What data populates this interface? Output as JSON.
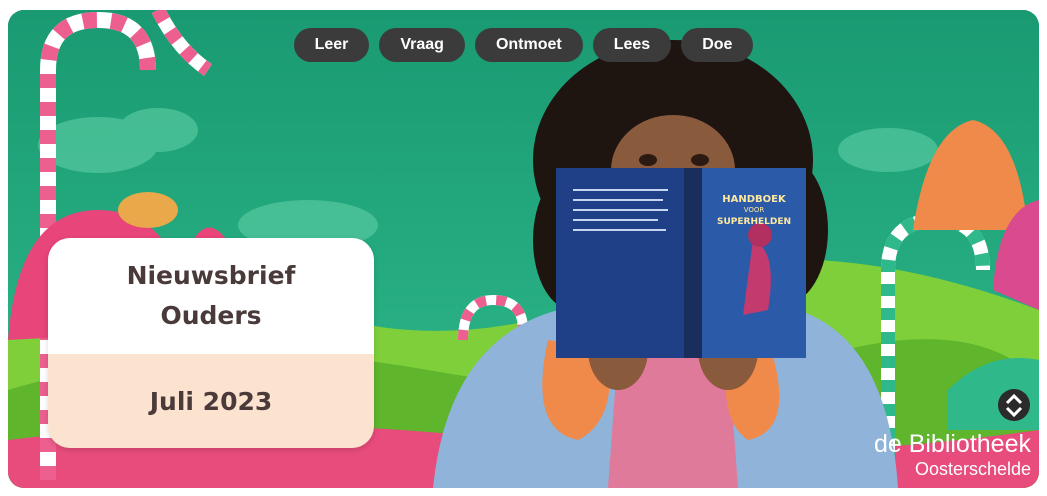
{
  "nav": {
    "items": [
      {
        "label": "Leer"
      },
      {
        "label": "Vraag"
      },
      {
        "label": "Ontmoet"
      },
      {
        "label": "Lees"
      },
      {
        "label": "Doe"
      }
    ]
  },
  "card": {
    "title_line1": "Nieuwsbrief",
    "title_line2": "Ouders",
    "date": "Juli 2023"
  },
  "book": {
    "title_line1": "HANDBOEK",
    "title_line2": "VOOR",
    "title_line3": "SUPERHELDEN"
  },
  "logo": {
    "name": "de Bibliotheek",
    "subtitle": "Oosterschelde",
    "icon": "bibliotheek-logo-icon"
  },
  "colors": {
    "background": "#1fa37c",
    "pill": "#3b3b3b",
    "card_top": "#ffffff",
    "card_bottom": "#fbe3cf",
    "text_dark": "#4a3a3a"
  }
}
